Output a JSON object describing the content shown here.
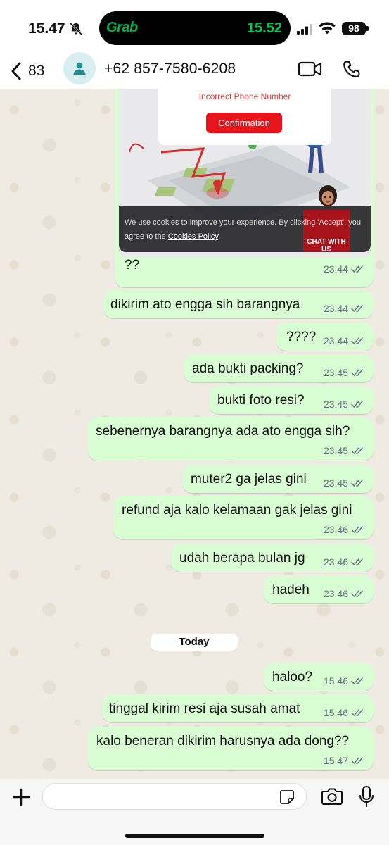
{
  "status_bar": {
    "time": "15.47",
    "island_app": "Grab",
    "island_time": "15.52",
    "battery": "98"
  },
  "header": {
    "back_count": "83",
    "contact": "+62 857-7580-6208"
  },
  "image_message": {
    "error_text": "Incorrect Phone Number",
    "button_label": "Confirmation",
    "cookie_text": "We use cookies to improve your experience. By clicking 'Accept', you agree to the ",
    "cookie_link": "Cookies Policy",
    "cookie_end": ".",
    "chat_badge": "CHAT WITH US"
  },
  "messages": [
    {
      "text": "??",
      "time": "23.44"
    },
    {
      "text": "dikirim ato engga sih barangnya",
      "time": "23.44"
    },
    {
      "text": "????",
      "time": "23.44"
    },
    {
      "text": "ada bukti packing?",
      "time": "23.45"
    },
    {
      "text": "bukti foto resi?",
      "time": "23.45"
    },
    {
      "text": "sebenernya barangnya ada ato engga sih?",
      "time": "23.45"
    },
    {
      "text": "muter2 ga jelas gini",
      "time": "23.45"
    },
    {
      "text": "refund aja kalo kelamaan gak jelas gini",
      "time": "23.46"
    },
    {
      "text": "udah berapa bulan jg",
      "time": "23.46"
    },
    {
      "text": "hadeh",
      "time": "23.46"
    },
    {
      "text": "haloo?",
      "time": "15.46"
    },
    {
      "text": "tinggal kirim resi aja susah amat",
      "time": "15.46"
    },
    {
      "text": "kalo beneran dikirim harusnya ada dong??",
      "time": "15.47"
    }
  ],
  "day_label": "Today",
  "input": {
    "value": "",
    "placeholder": ""
  },
  "colors": {
    "bubble_out": "#d9fdd3",
    "chat_bg": "#efeae2",
    "tick_gray": "#667781",
    "grab_green": "#00b14f"
  },
  "icons": [
    "bell-slash-icon",
    "signal-icon",
    "wifi-icon",
    "back-chevron-icon",
    "person-icon",
    "video-icon",
    "phone-icon",
    "double-check-icon",
    "plus-icon",
    "sticker-icon",
    "camera-icon",
    "mic-icon"
  ]
}
